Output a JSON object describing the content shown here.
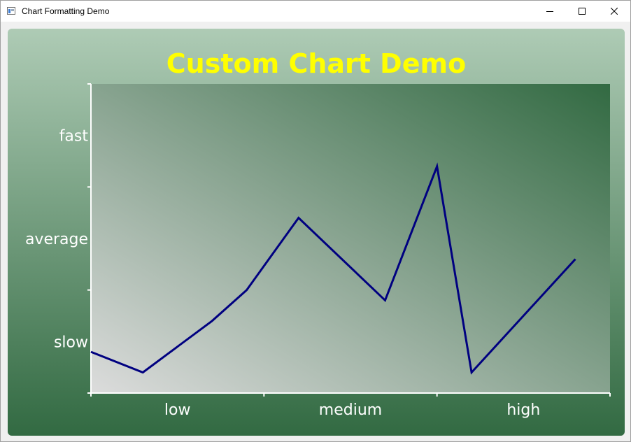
{
  "window": {
    "title": "Chart Formatting Demo",
    "minimize_icon": "minimize-icon",
    "maximize_icon": "maximize-icon",
    "close_icon": "close-icon"
  },
  "colors": {
    "title": "#ffff00",
    "series_line": "#000080",
    "axis": "#ffffff",
    "label": "#ffffff",
    "background_top": "#aecbb5",
    "background_bottom": "#326a42",
    "plot_light": "#dcdcdc",
    "plot_dark": "#326a42"
  },
  "chart_data": {
    "type": "line",
    "title": "Custom Chart Demo",
    "x_categories": [
      "low",
      "medium",
      "high"
    ],
    "y_categories": [
      "slow",
      "average",
      "fast"
    ],
    "xlim": [
      0,
      3
    ],
    "ylim": [
      0,
      3
    ],
    "series": [
      {
        "x": [
          0.0,
          0.3,
          0.7,
          0.9,
          1.2,
          1.7,
          2.0,
          2.2,
          2.8
        ],
        "y": [
          0.4,
          0.2,
          0.7,
          1.0,
          1.7,
          0.9,
          2.2,
          0.2,
          1.3
        ]
      }
    ],
    "grid": false,
    "legend": "none"
  }
}
